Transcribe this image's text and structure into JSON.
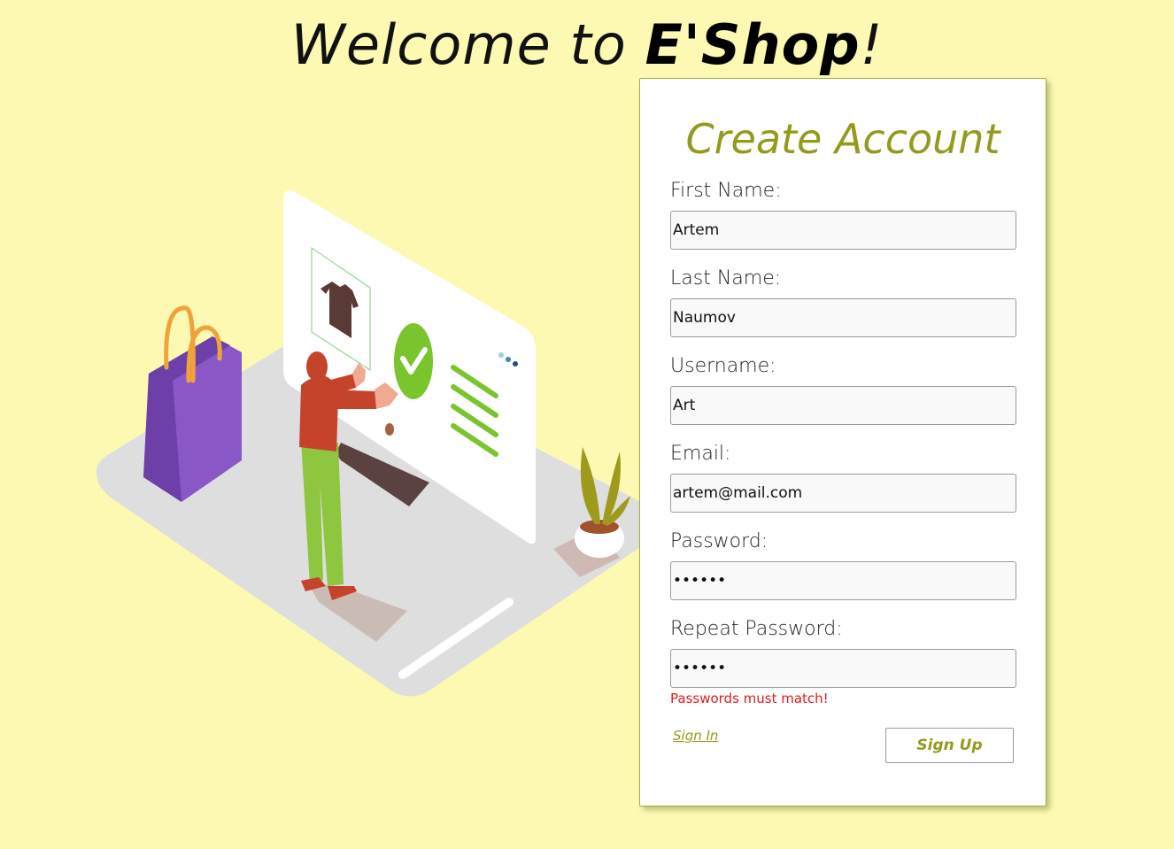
{
  "header": {
    "welcome_prefix": "Welcome to ",
    "brand": "E'Shop",
    "welcome_suffix": "!"
  },
  "form": {
    "title": "Create Account",
    "fields": [
      {
        "label": "First Name:",
        "value": "Artem",
        "type": "text"
      },
      {
        "label": "Last Name:",
        "value": "Naumov",
        "type": "text"
      },
      {
        "label": "Username:",
        "value": "Art",
        "type": "text"
      },
      {
        "label": "Email:",
        "value": "artem@mail.com",
        "type": "email"
      },
      {
        "label": "Password:",
        "value": "••••••",
        "type": "password"
      },
      {
        "label": "Repeat Password:",
        "value": "••••••",
        "type": "password"
      }
    ],
    "error": "Passwords must match!",
    "signin_link": "Sign In",
    "signup_button": "Sign Up"
  },
  "colors": {
    "background": "#fdf9b2",
    "accent": "#949a1c",
    "error": "#e01b1b",
    "card_border": "#9bb33a"
  },
  "illustration": {
    "description_icons": [
      "shopping-bag-icon",
      "tshirt-icon",
      "checkmark-icon",
      "plant-icon",
      "shopper-figure"
    ]
  }
}
